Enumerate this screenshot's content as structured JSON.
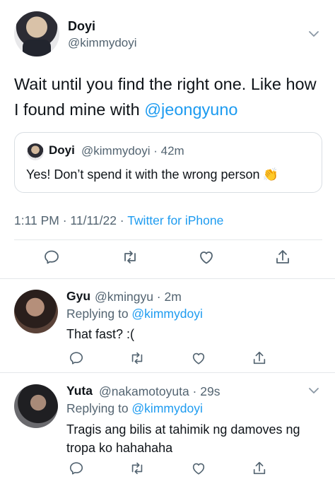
{
  "main_tweet": {
    "author_name": "Doyi",
    "author_handle": "@kimmydoyi",
    "text_before": "Wait until you find the right one. Like how I found mine with ",
    "mention": "@jeongyuno",
    "quote": {
      "author_name": "Doyi",
      "meta": "@kimmydoyi · 42m",
      "text": "Yes! Don’t spend it with the wrong person",
      "emoji": "👏"
    },
    "timestamp": "1:11 PM · 11/11/22 · ",
    "source": "Twitter for iPhone"
  },
  "replies": [
    {
      "author_name": "Gyu",
      "meta": "@kmingyu · 2m",
      "replying_label": "Replying to ",
      "replying_to": "@kimmydoyi",
      "text": "That fast? :("
    },
    {
      "author_name": "Yuta",
      "meta": "@nakamotoyuta · 29s",
      "replying_label": "Replying to ",
      "replying_to": "@kimmydoyi",
      "text": "Tragis ang bilis at tahimik ng damoves ng tropa ko hahahaha"
    }
  ],
  "icons": [
    "chevron-down-icon",
    "reply-icon",
    "retweet-icon",
    "like-icon",
    "share-icon"
  ],
  "colors": {
    "accent": "#1d9bf0",
    "text": "#0f1419",
    "secondary": "#536471",
    "divider": "#e4e7ea"
  }
}
